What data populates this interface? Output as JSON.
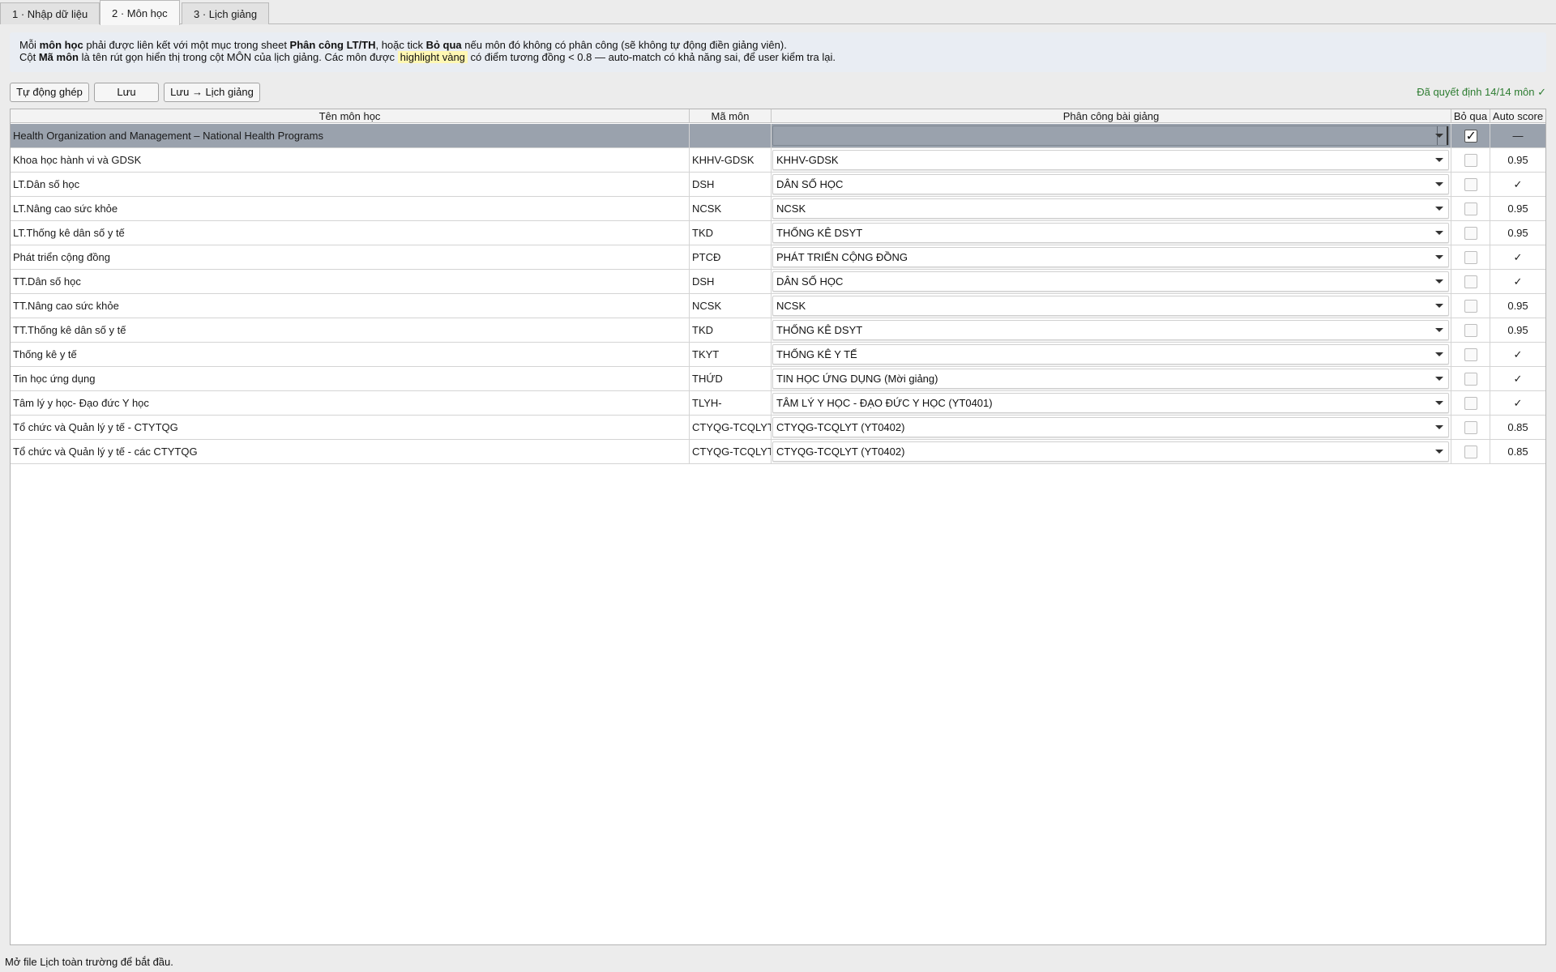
{
  "tabs": [
    {
      "label": "1 · Nhập dữ liệu",
      "active": false
    },
    {
      "label": "2 · Môn học",
      "active": true
    },
    {
      "label": "3 · Lịch giảng",
      "active": false
    }
  ],
  "info": {
    "l1_a": "Mỗi ",
    "l1_b": "môn học",
    "l1_c": " phải được liên kết với một mục trong sheet ",
    "l1_d": "Phân công LT/TH",
    "l1_e": ", hoặc tick ",
    "l1_f": "Bỏ qua",
    "l1_g": " nếu môn đó không có phân công (sẽ không tự động điền giảng viên).",
    "l2_a": "Cột ",
    "l2_b": "Mã môn",
    "l2_c": " là tên rút gọn hiển thị trong cột MÔN của lịch giảng. Các môn được ",
    "l2_d": "highlight vàng",
    "l2_e": " có điểm tương đồng < 0.8 — auto-match có khả năng sai, để user kiểm tra lại."
  },
  "toolbar": {
    "auto_label": "Tự động ghép",
    "save_label": "Lưu",
    "save_schedule_label": "Lưu → Lịch giảng",
    "status": "Đã quyết định 14/14 môn ✓"
  },
  "table": {
    "headers": [
      "Tên môn học",
      "Mã môn",
      "Phân công bài giảng",
      "Bỏ qua",
      "Auto score"
    ],
    "rows": [
      {
        "name": "Health Organization and Management – National Health Programs",
        "code": "",
        "assign": "",
        "skip": true,
        "score": "—",
        "selected": true
      },
      {
        "name": "Khoa học hành vi và GDSK",
        "code": "KHHV-GDSK",
        "assign": "KHHV-GDSK",
        "skip": false,
        "score": "0.95"
      },
      {
        "name": "LT.Dân số học",
        "code": "DSH",
        "assign": "DÂN SỐ HỌC",
        "skip": false,
        "score": "✓"
      },
      {
        "name": "LT.Nâng cao sức khỏe",
        "code": "NCSK",
        "assign": "NCSK",
        "skip": false,
        "score": "0.95"
      },
      {
        "name": "LT.Thống kê dân số y tế",
        "code": "TKD",
        "assign": "THỐNG KÊ DSYT",
        "skip": false,
        "score": "0.95"
      },
      {
        "name": "Phát triển cộng đồng",
        "code": "PTCĐ",
        "assign": "PHÁT TRIỂN CỘNG ĐỒNG",
        "skip": false,
        "score": "✓"
      },
      {
        "name": "TT.Dân số học",
        "code": "DSH",
        "assign": "DÂN SỐ HỌC",
        "skip": false,
        "score": "✓"
      },
      {
        "name": "TT.Nâng cao sức khỏe",
        "code": "NCSK",
        "assign": "NCSK",
        "skip": false,
        "score": "0.95"
      },
      {
        "name": "TT.Thống kê dân số y tế",
        "code": "TKD",
        "assign": "THỐNG KÊ DSYT",
        "skip": false,
        "score": "0.95"
      },
      {
        "name": "Thống kê y  tế",
        "code": "TKYT",
        "assign": "THỐNG KÊ Y TẾ",
        "skip": false,
        "score": "✓"
      },
      {
        "name": "Tin học ứng dụng",
        "code": "THỨD",
        "assign": "TIN HỌC ỨNG DỤNG (Mời giảng)",
        "skip": false,
        "score": "✓"
      },
      {
        "name": "Tâm lý y học- Đạo đức Y học",
        "code": "TLYH-",
        "assign": "TÂM LÝ Y HỌC - ĐẠO ĐỨC Y HỌC  (YT0401)",
        "skip": false,
        "score": "✓"
      },
      {
        "name": "Tổ chức và Quản lý y tế - CTYTQG",
        "code": "CTYQG-TCQLYT",
        "assign": "CTYQG-TCQLYT (YT0402)",
        "skip": false,
        "score": "0.85"
      },
      {
        "name": "Tổ chức và Quản lý y tế - các CTYTQG",
        "code": "CTYQG-TCQLYT",
        "assign": "CTYQG-TCQLYT (YT0402)",
        "skip": false,
        "score": "0.85"
      }
    ]
  },
  "statusbar": {
    "text": "Mở file Lịch toàn trường để bắt đầu."
  },
  "colors": {
    "accent_status": "#2e7d32",
    "selected_row": "#9aa2ad",
    "highlight": "#fff7b3",
    "info_bg": "#e9edf3"
  },
  "icons": {
    "dropdown": "chevron-down-icon",
    "checkbox": "checkbox-icon",
    "check": "check-icon"
  }
}
